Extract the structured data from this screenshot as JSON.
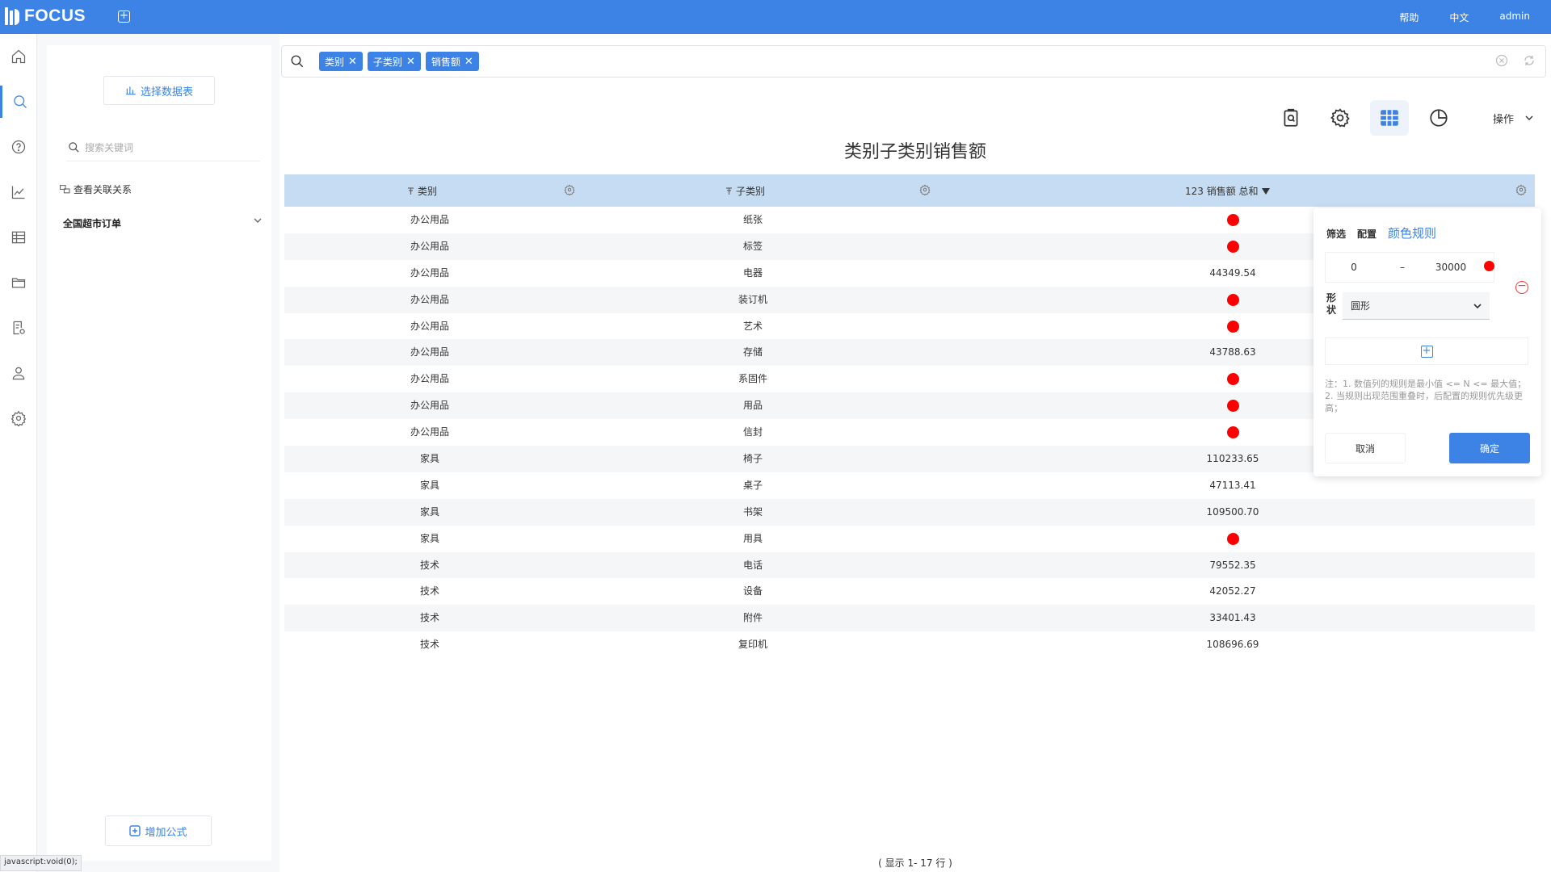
{
  "app": {
    "logo_text": "FOCUS",
    "top_links": [
      "帮助",
      "中文",
      "admin"
    ]
  },
  "nav_icons": [
    "home-icon",
    "search-icon",
    "help-icon",
    "chart-board-icon",
    "table-icon",
    "folder-icon",
    "report-settings-icon",
    "user-icon",
    "gear-icon"
  ],
  "datapanel": {
    "select_table_label": "选择数据表",
    "search_placeholder": "搜索关键词",
    "relation_link": "查看关联关系",
    "source_name": "全国超市订单",
    "add_formula_label": "增加公式"
  },
  "search": {
    "chips": [
      "类别",
      "子类别",
      "销售额"
    ]
  },
  "toolbar": {
    "ops_label": "操作"
  },
  "table": {
    "title": "类别子类别销售额",
    "headers": [
      "类别",
      "子类别",
      "123 销售额 总和"
    ],
    "rows": [
      {
        "cat": "办公用品",
        "sub": "纸张",
        "val": null
      },
      {
        "cat": "办公用品",
        "sub": "标签",
        "val": null
      },
      {
        "cat": "办公用品",
        "sub": "电器",
        "val": "44349.54"
      },
      {
        "cat": "办公用品",
        "sub": "装订机",
        "val": null
      },
      {
        "cat": "办公用品",
        "sub": "艺术",
        "val": null
      },
      {
        "cat": "办公用品",
        "sub": "存储",
        "val": "43788.63"
      },
      {
        "cat": "办公用品",
        "sub": "系固件",
        "val": null
      },
      {
        "cat": "办公用品",
        "sub": "用品",
        "val": null
      },
      {
        "cat": "办公用品",
        "sub": "信封",
        "val": null
      },
      {
        "cat": "家具",
        "sub": "椅子",
        "val": "110233.65"
      },
      {
        "cat": "家具",
        "sub": "桌子",
        "val": "47113.41"
      },
      {
        "cat": "家具",
        "sub": "书架",
        "val": "109500.70"
      },
      {
        "cat": "家具",
        "sub": "用具",
        "val": null
      },
      {
        "cat": "技术",
        "sub": "电话",
        "val": "79552.35"
      },
      {
        "cat": "技术",
        "sub": "设备",
        "val": "42052.27"
      },
      {
        "cat": "技术",
        "sub": "附件",
        "val": "33401.43"
      },
      {
        "cat": "技术",
        "sub": "复印机",
        "val": "108696.69"
      }
    ],
    "footer": "( 显示 1- 17 行 )"
  },
  "color_rule": {
    "tabs": [
      "筛选",
      "配置",
      "颜色规则"
    ],
    "range_min": "0",
    "range_sep": "–",
    "range_max": "30000",
    "shape_label": "形状",
    "shape_value": "圆形",
    "note": "注：1. 数值列的规则是最小值 <= N <= 最大值；2. 当规则出现范围重叠时，后配置的规则优先级更高；",
    "cancel_label": "取消",
    "ok_label": "确定",
    "rule_color": "#ff0000"
  },
  "statusbar": "javascript:void(0);"
}
